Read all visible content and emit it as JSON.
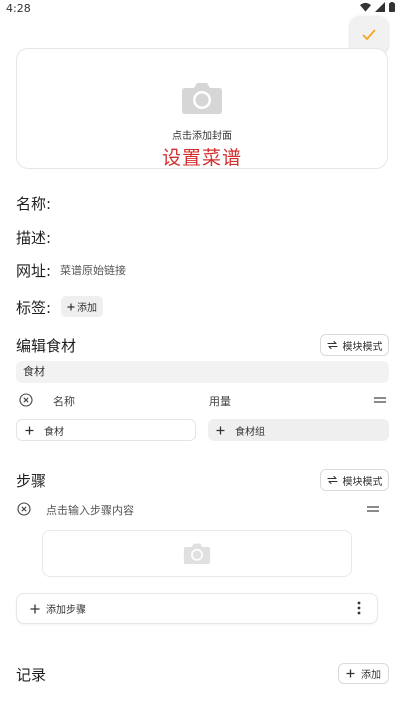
{
  "status_bar": {
    "time": "4:28"
  },
  "cover": {
    "hint": "点击添加封面",
    "title": "设置菜谱"
  },
  "fields": {
    "name_label": "名称:",
    "desc_label": "描述:",
    "url_label": "网址:",
    "url_placeholder": "菜谱原始链接",
    "tags_label": "标签:",
    "tags_add": "添加"
  },
  "ingredients": {
    "title": "编辑食材",
    "mode_button": "模块模式",
    "group_header": "食材",
    "col_name": "名称",
    "col_amount": "用量",
    "add_ingredient": "食材",
    "add_group": "食材组"
  },
  "steps": {
    "title": "步骤",
    "mode_button": "模块模式",
    "step_placeholder": "点击输入步骤内容",
    "add_step": "添加步骤"
  },
  "records": {
    "title": "记录",
    "add": "添加"
  },
  "colors": {
    "accent": "#f5a623",
    "title_red": "#d32f2f",
    "icon_gray": "#d6d6d6"
  }
}
